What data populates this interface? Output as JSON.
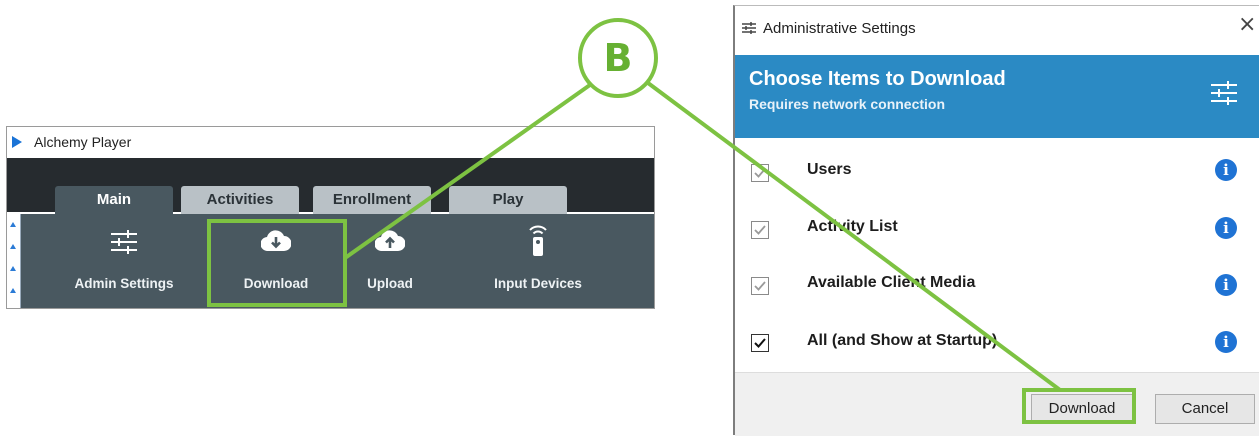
{
  "player": {
    "title": "Alchemy Player",
    "tabs": [
      {
        "label": "Main",
        "active": true
      },
      {
        "label": "Activities",
        "active": false
      },
      {
        "label": "Enrollment",
        "active": false
      },
      {
        "label": "Play",
        "active": false
      }
    ],
    "ribbon_buttons": [
      {
        "label": "Admin Settings",
        "icon": "sliders-icon"
      },
      {
        "label": "Download",
        "icon": "cloud-download-icon"
      },
      {
        "label": "Upload",
        "icon": "cloud-upload-icon"
      },
      {
        "label": "Input Devices",
        "icon": "remote-icon"
      }
    ]
  },
  "dialog": {
    "title": "Administrative Settings",
    "close_glyph": "×",
    "heading": "Choose Items to Download",
    "subheading": "Requires network connection",
    "items": [
      {
        "label": "Users",
        "checked": true,
        "disabled": true
      },
      {
        "label": "Activity List",
        "checked": true,
        "disabled": true
      },
      {
        "label": "Available Client Media",
        "checked": true,
        "disabled": true
      },
      {
        "label": "All (and Show at Startup)",
        "checked": true,
        "disabled": false
      }
    ],
    "info_glyph": "i",
    "download_label": "Download",
    "cancel_label": "Cancel"
  },
  "annotation": {
    "callout_label": "B",
    "color": "#7dc242"
  },
  "colors": {
    "header_blue": "#2b8ac4",
    "ribbon": "#495860",
    "dark_bar": "#262b2f",
    "info_blue": "#1f73d4"
  }
}
